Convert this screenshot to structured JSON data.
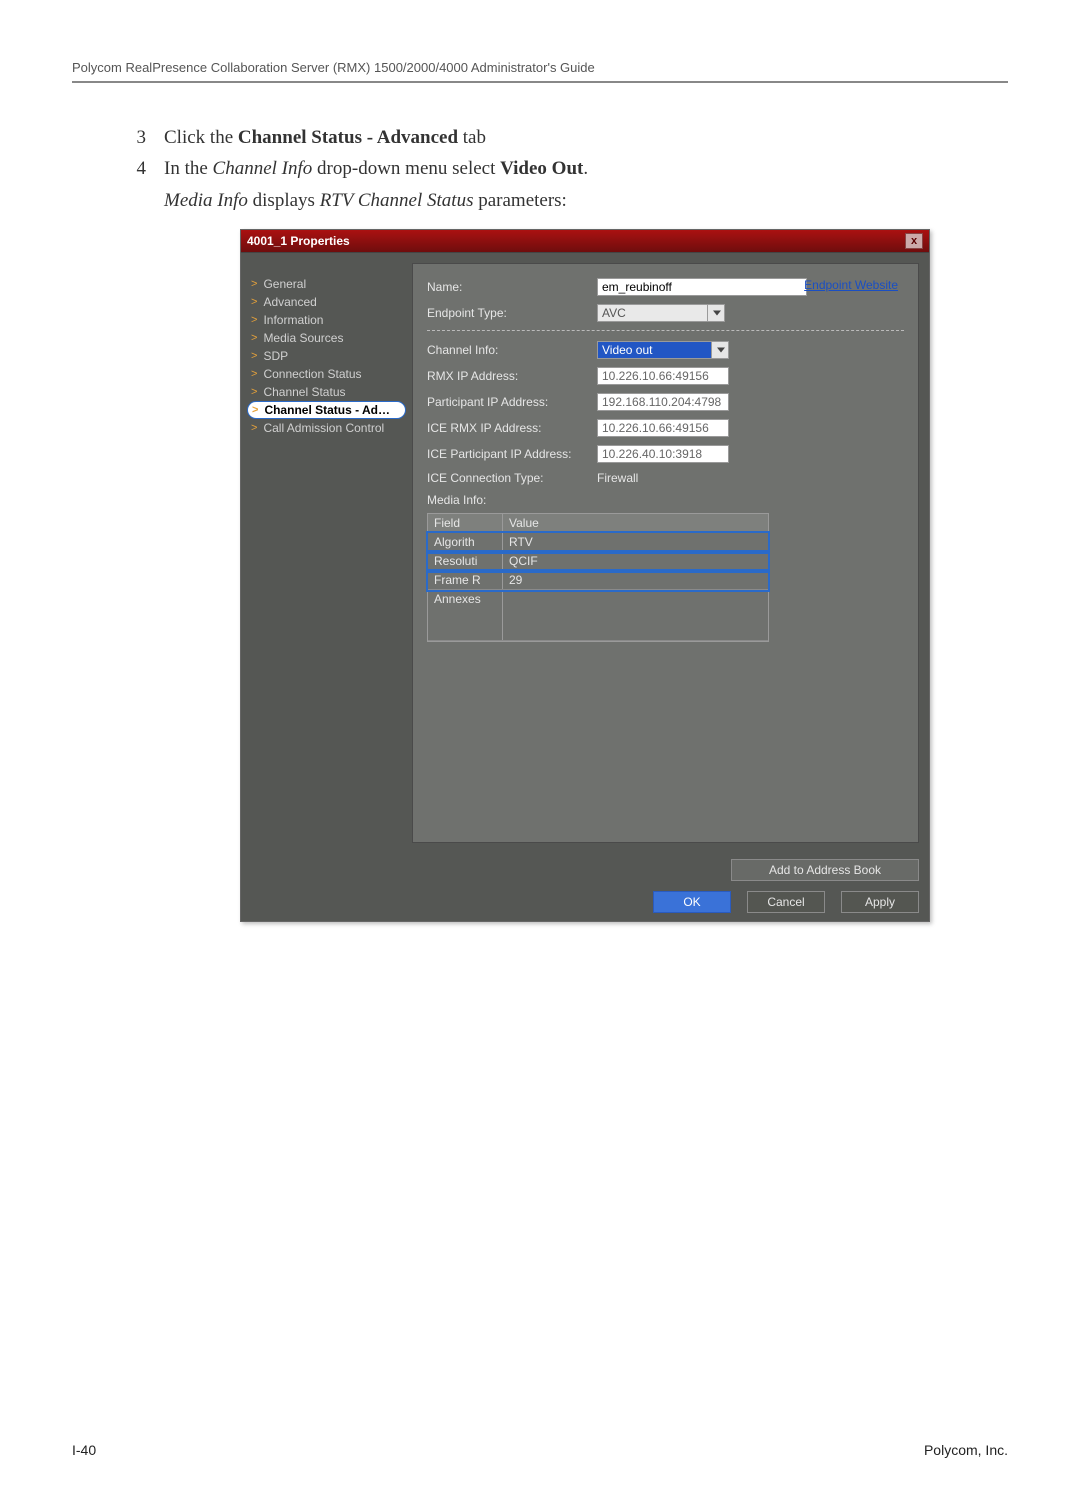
{
  "header": {
    "running": "Polycom RealPresence Collaboration Server (RMX) 1500/2000/4000 Administrator's Guide"
  },
  "steps": {
    "s3": {
      "num": "3",
      "pre": "Click the ",
      "bold": "Channel Status - Advanced",
      "post": " tab"
    },
    "s4": {
      "num": "4",
      "pre": "In the ",
      "ital": "Channel Info",
      "mid": " drop-down menu select ",
      "bold": "Video Out",
      "post": "."
    },
    "cont": {
      "ital1": "Media Info",
      "mid": " displays ",
      "ital2": "RTV Channel Status",
      "post": " parameters:"
    }
  },
  "dialog": {
    "title": "4001_1 Properties",
    "close": "x",
    "nav": {
      "items": [
        "General",
        "Advanced",
        "Information",
        "Media Sources",
        "SDP",
        "Connection Status",
        "Channel Status",
        "Channel Status - Ad…",
        "Call Admission Control"
      ],
      "selectedIndex": 7
    },
    "link": "Endpoint Website",
    "fields": {
      "name": {
        "label": "Name:",
        "value": "em_reubinoff"
      },
      "endpointType": {
        "label": "Endpoint Type:",
        "value": "AVC"
      },
      "channelInfo": {
        "label": "Channel Info:",
        "value": "Video out"
      },
      "rmxIp": {
        "label": "RMX IP Address:",
        "value": "10.226.10.66:49156"
      },
      "partIp": {
        "label": "Participant IP Address:",
        "value": "192.168.110.204:4798"
      },
      "iceRmxIp": {
        "label": "ICE RMX IP Address:",
        "value": "10.226.10.66:49156"
      },
      "icePartIp": {
        "label": "ICE Participant IP Address:",
        "value": "10.226.40.10:3918"
      },
      "iceConn": {
        "label": "ICE Connection Type:",
        "value": "Firewall"
      }
    },
    "media": {
      "label": "Media Info:",
      "headers": {
        "field": "Field",
        "value": "Value"
      },
      "rows": [
        {
          "field": "Algorith",
          "value": "RTV"
        },
        {
          "field": "Resoluti",
          "value": "QCIF"
        },
        {
          "field": "Frame R",
          "value": "29"
        },
        {
          "field": "Annexes",
          "value": ""
        }
      ]
    },
    "buttons": {
      "addBook": "Add to Address Book",
      "ok": "OK",
      "cancel": "Cancel",
      "apply": "Apply"
    }
  },
  "footer": {
    "left": "I-40",
    "right": "Polycom, Inc."
  }
}
